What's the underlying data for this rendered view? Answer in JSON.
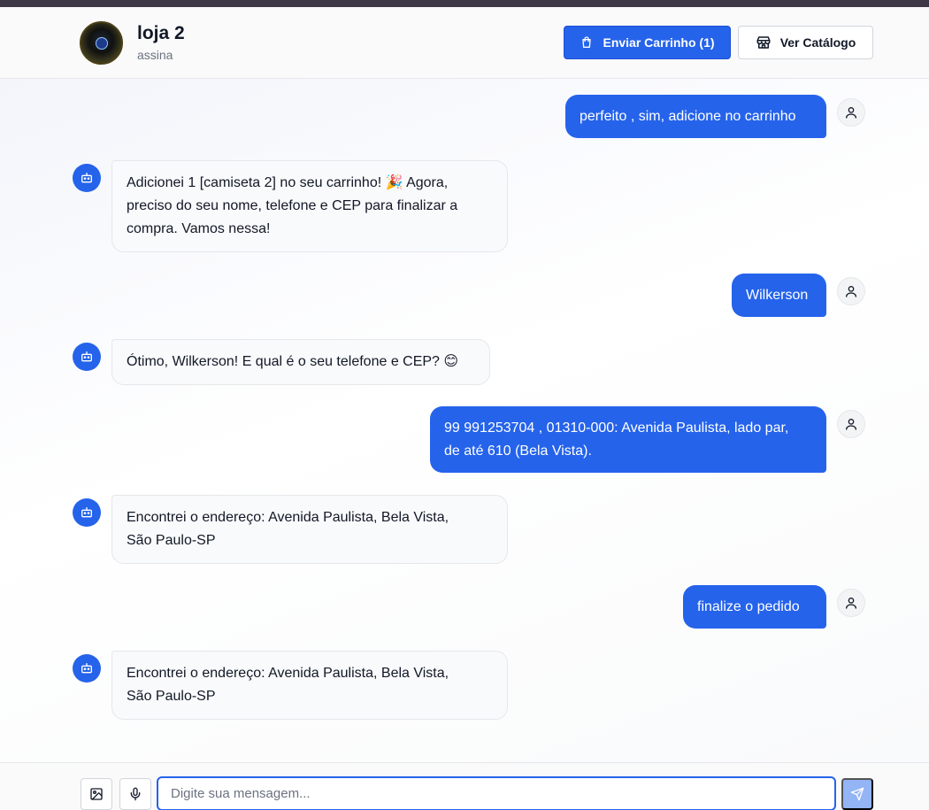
{
  "header": {
    "store_name": "loja 2",
    "store_subtitle": "assina",
    "cart_button_label": "Enviar Carrinho (1)",
    "catalog_button_label": "Ver Catálogo"
  },
  "messages": [
    {
      "role": "user",
      "text": "perfeito , sim, adicione no carrinho"
    },
    {
      "role": "bot",
      "lines": [
        "Adicionei 1 [camiseta 2] no seu carrinho! 🎉  Agora,",
        "preciso do seu nome, telefone e CEP para finalizar a",
        "compra. Vamos nessa!"
      ]
    },
    {
      "role": "user",
      "text": "Wilkerson"
    },
    {
      "role": "bot",
      "lines": [
        "Ótimo, Wilkerson! E qual é o seu telefone e CEP? 😊"
      ]
    },
    {
      "role": "user",
      "lines": [
        "99 991253704 , 01310-000: Avenida Paulista, lado par,",
        "de até 610 (Bela Vista)."
      ]
    },
    {
      "role": "bot",
      "lines": [
        "Encontrei o endereço: Avenida Paulista, Bela Vista,",
        "São Paulo-SP"
      ]
    },
    {
      "role": "user",
      "text": "finalize o pedido"
    },
    {
      "role": "bot",
      "lines": [
        "Encontrei o endereço: Avenida Paulista, Bela Vista,",
        "São Paulo-SP"
      ]
    }
  ],
  "composer": {
    "placeholder": "Digite sua mensagem...",
    "value": ""
  },
  "colors": {
    "accent": "#2563eb",
    "send_disabled": "#93b4f5"
  },
  "icons": {
    "cart": "shopping-bag-icon",
    "catalog": "store-icon",
    "user": "user-icon",
    "bot": "bot-icon",
    "image": "image-icon",
    "mic": "microphone-icon",
    "send": "send-icon"
  }
}
